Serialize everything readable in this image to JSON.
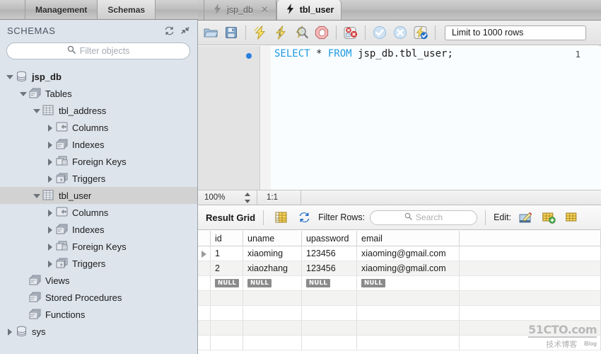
{
  "sidebar": {
    "tabs": [
      {
        "label": "Management",
        "active": false
      },
      {
        "label": "Schemas",
        "active": true
      }
    ],
    "panel_title": "SCHEMAS",
    "header_icons": [
      {
        "name": "refresh-icon"
      },
      {
        "name": "collapse-all-icon"
      }
    ],
    "filter": {
      "placeholder": "Filter objects",
      "value": "",
      "icon": "search-icon"
    },
    "tree": [
      {
        "label": "jsp_db",
        "indent": 0,
        "twisty": "down",
        "icon": "schema-icon",
        "bold": true,
        "selected": false
      },
      {
        "label": "Tables",
        "indent": 1,
        "twisty": "down",
        "icon": "folder-icon",
        "bold": false,
        "selected": false
      },
      {
        "label": "tbl_address",
        "indent": 2,
        "twisty": "down",
        "icon": "table-icon",
        "bold": false,
        "selected": false
      },
      {
        "label": "Columns",
        "indent": 3,
        "twisty": "right",
        "icon": "columns-icon",
        "bold": false,
        "selected": false
      },
      {
        "label": "Indexes",
        "indent": 3,
        "twisty": "right",
        "icon": "folder-icon",
        "bold": false,
        "selected": false
      },
      {
        "label": "Foreign Keys",
        "indent": 3,
        "twisty": "right",
        "icon": "fkeys-icon",
        "bold": false,
        "selected": false
      },
      {
        "label": "Triggers",
        "indent": 3,
        "twisty": "right",
        "icon": "trigger-icon",
        "bold": false,
        "selected": false
      },
      {
        "label": "tbl_user",
        "indent": 2,
        "twisty": "down",
        "icon": "table-icon",
        "bold": false,
        "selected": true
      },
      {
        "label": "Columns",
        "indent": 3,
        "twisty": "right",
        "icon": "columns-icon",
        "bold": false,
        "selected": false
      },
      {
        "label": "Indexes",
        "indent": 3,
        "twisty": "right",
        "icon": "folder-icon",
        "bold": false,
        "selected": false
      },
      {
        "label": "Foreign Keys",
        "indent": 3,
        "twisty": "right",
        "icon": "fkeys-icon",
        "bold": false,
        "selected": false
      },
      {
        "label": "Triggers",
        "indent": 3,
        "twisty": "right",
        "icon": "trigger-icon",
        "bold": false,
        "selected": false
      },
      {
        "label": "Views",
        "indent": 1,
        "twisty": "none",
        "icon": "folder-icon",
        "bold": false,
        "selected": false
      },
      {
        "label": "Stored Procedures",
        "indent": 1,
        "twisty": "none",
        "icon": "folder-icon",
        "bold": false,
        "selected": false
      },
      {
        "label": "Functions",
        "indent": 1,
        "twisty": "none",
        "icon": "folder-icon",
        "bold": false,
        "selected": false
      },
      {
        "label": "sys",
        "indent": 0,
        "twisty": "right",
        "icon": "schema-icon",
        "bold": false,
        "selected": false
      }
    ]
  },
  "editor": {
    "tabs": [
      {
        "label": "jsp_db",
        "active": false,
        "closable": true,
        "icon": "lightning-icon"
      },
      {
        "label": "tbl_user",
        "active": true,
        "closable": false,
        "icon": "lightning-icon"
      }
    ],
    "toolbar_buttons": [
      {
        "name": "open-sql-script-icon",
        "title": "Open a SQL script file"
      },
      {
        "name": "save-sql-script-icon",
        "title": "Save the script"
      },
      {
        "name": "execute-statement-icon",
        "title": "Execute statement"
      },
      {
        "name": "execute-current-icon",
        "title": "Execute current statement"
      },
      {
        "name": "explain-query-icon",
        "title": "Explain query"
      },
      {
        "name": "stop-execution-icon",
        "title": "Stop statement execution"
      },
      {
        "name": "toggle-stop-on-error-icon",
        "title": "Toggle stop on error"
      },
      {
        "name": "commit-icon",
        "title": "Commit transaction"
      },
      {
        "name": "rollback-icon",
        "title": "Rollback transaction"
      },
      {
        "name": "autocommit-icon",
        "title": "Toggle auto-commit"
      }
    ],
    "row_limit": "Limit to 1000 rows",
    "line_number": "1",
    "sql": {
      "keyword1": "SELECT",
      "star": " * ",
      "keyword2": "FROM",
      "rest": " jsp_db.tbl_user;"
    },
    "status": {
      "zoom": "100%",
      "ratio": "1:1"
    }
  },
  "result_panel": {
    "title": "Result Grid",
    "toolbar_icons": [
      {
        "name": "grid-view-icon"
      },
      {
        "name": "refresh-result-icon"
      }
    ],
    "filter_label": "Filter Rows:",
    "search_placeholder": "Search",
    "search_value": "",
    "edit_label": "Edit:",
    "edit_icons": [
      {
        "name": "edit-row-icon"
      },
      {
        "name": "insert-row-icon"
      },
      {
        "name": "delete-row-icon"
      }
    ],
    "columns": [
      "id",
      "uname",
      "upassword",
      "email"
    ],
    "rows": [
      {
        "selected": true,
        "cells": [
          "1",
          "xiaoming",
          "123456",
          "xiaoming@gmail.com"
        ]
      },
      {
        "selected": false,
        "cells": [
          "2",
          "xiaozhang",
          "123456",
          "xiaoming@gmail.com"
        ]
      }
    ],
    "new_row_placeholder": "NULL",
    "empty_row_count": 4
  },
  "watermark": {
    "main": "51CTO.com",
    "sub": "技术博客",
    "badge": "Blog"
  },
  "colors": {
    "sidebar_bg": "#dde4ec",
    "selection": "#d2d2d2",
    "sql_keyword": "#1e9ae0",
    "bookmark_dot": "#2a7fe0",
    "null_badge": "#8b8b8b",
    "grid_alt_row": "#f3f4f2"
  }
}
